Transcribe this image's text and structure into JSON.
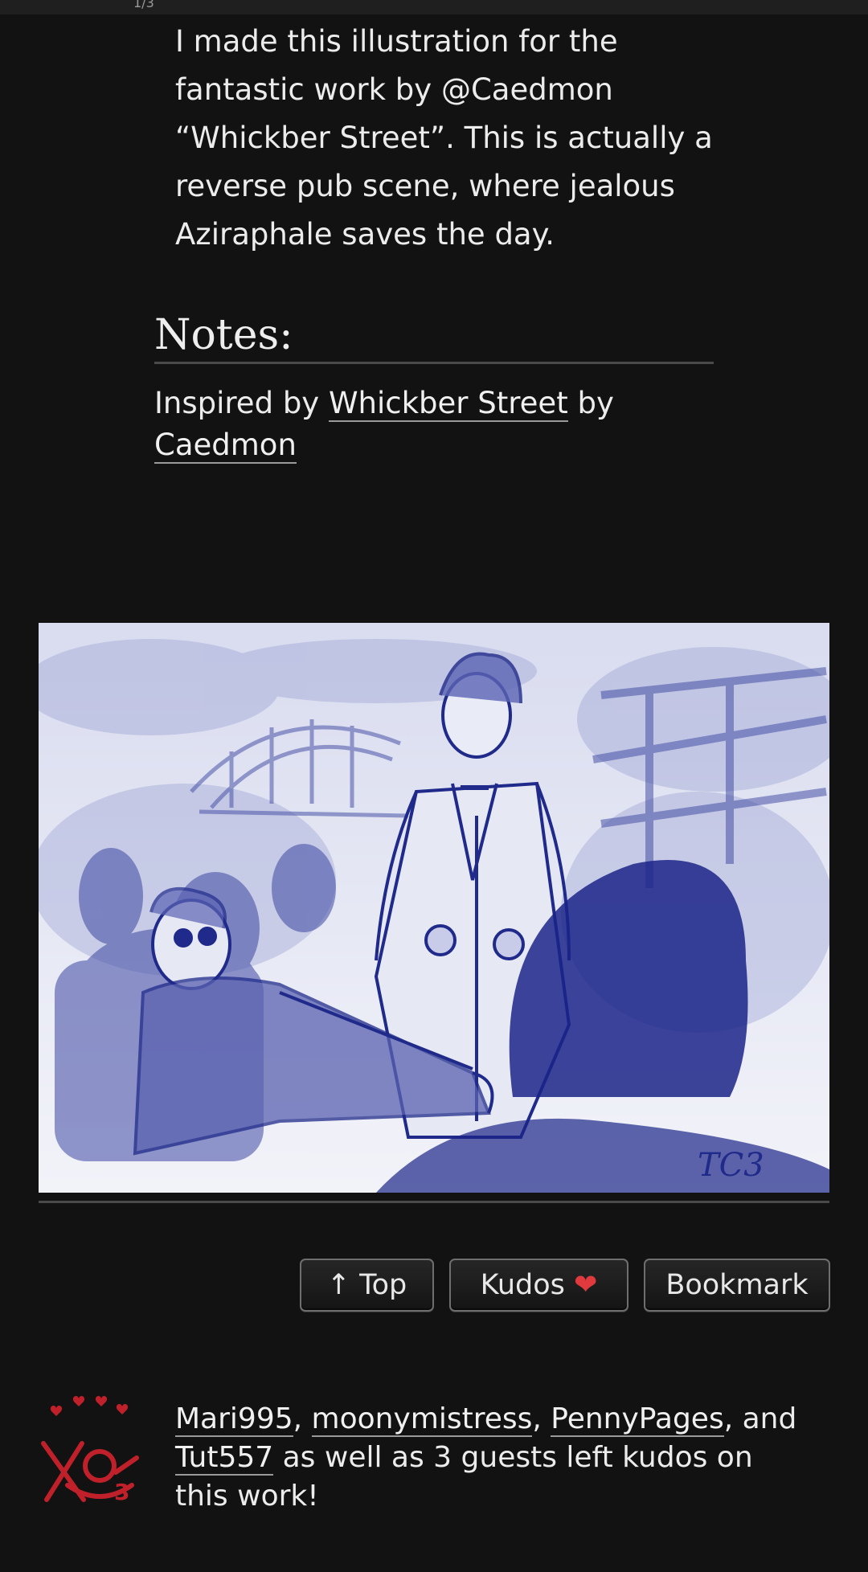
{
  "work": {
    "summary": "I made this illustration for the fantastic work by @Caedmon “Whickber Street”. This is actually a reverse pub scene, where jealous Aziraphale saves the day."
  },
  "notes": {
    "heading": "Notes:",
    "prefix": "Inspired by ",
    "work_link": "Whickber Street",
    "by": " by ",
    "author_link": "Caedmon"
  },
  "illustration": {
    "signature": "TC3"
  },
  "actions": {
    "top_label": "↑ Top",
    "kudos_label": "Kudos",
    "kudos_icon": "heart-icon",
    "bookmark_label": "Bookmark"
  },
  "kudos": {
    "users": [
      "Mari995",
      "moonymistress",
      "PennyPages",
      "Tut557"
    ],
    "sep1": ", ",
    "sep2": ", ",
    "sep3": ", and ",
    "tail": " as well as 3 guests left kudos on this work!"
  },
  "colors": {
    "background": "#121212",
    "accent_heart": "#e0393e",
    "ink": "#1f2a8a"
  }
}
